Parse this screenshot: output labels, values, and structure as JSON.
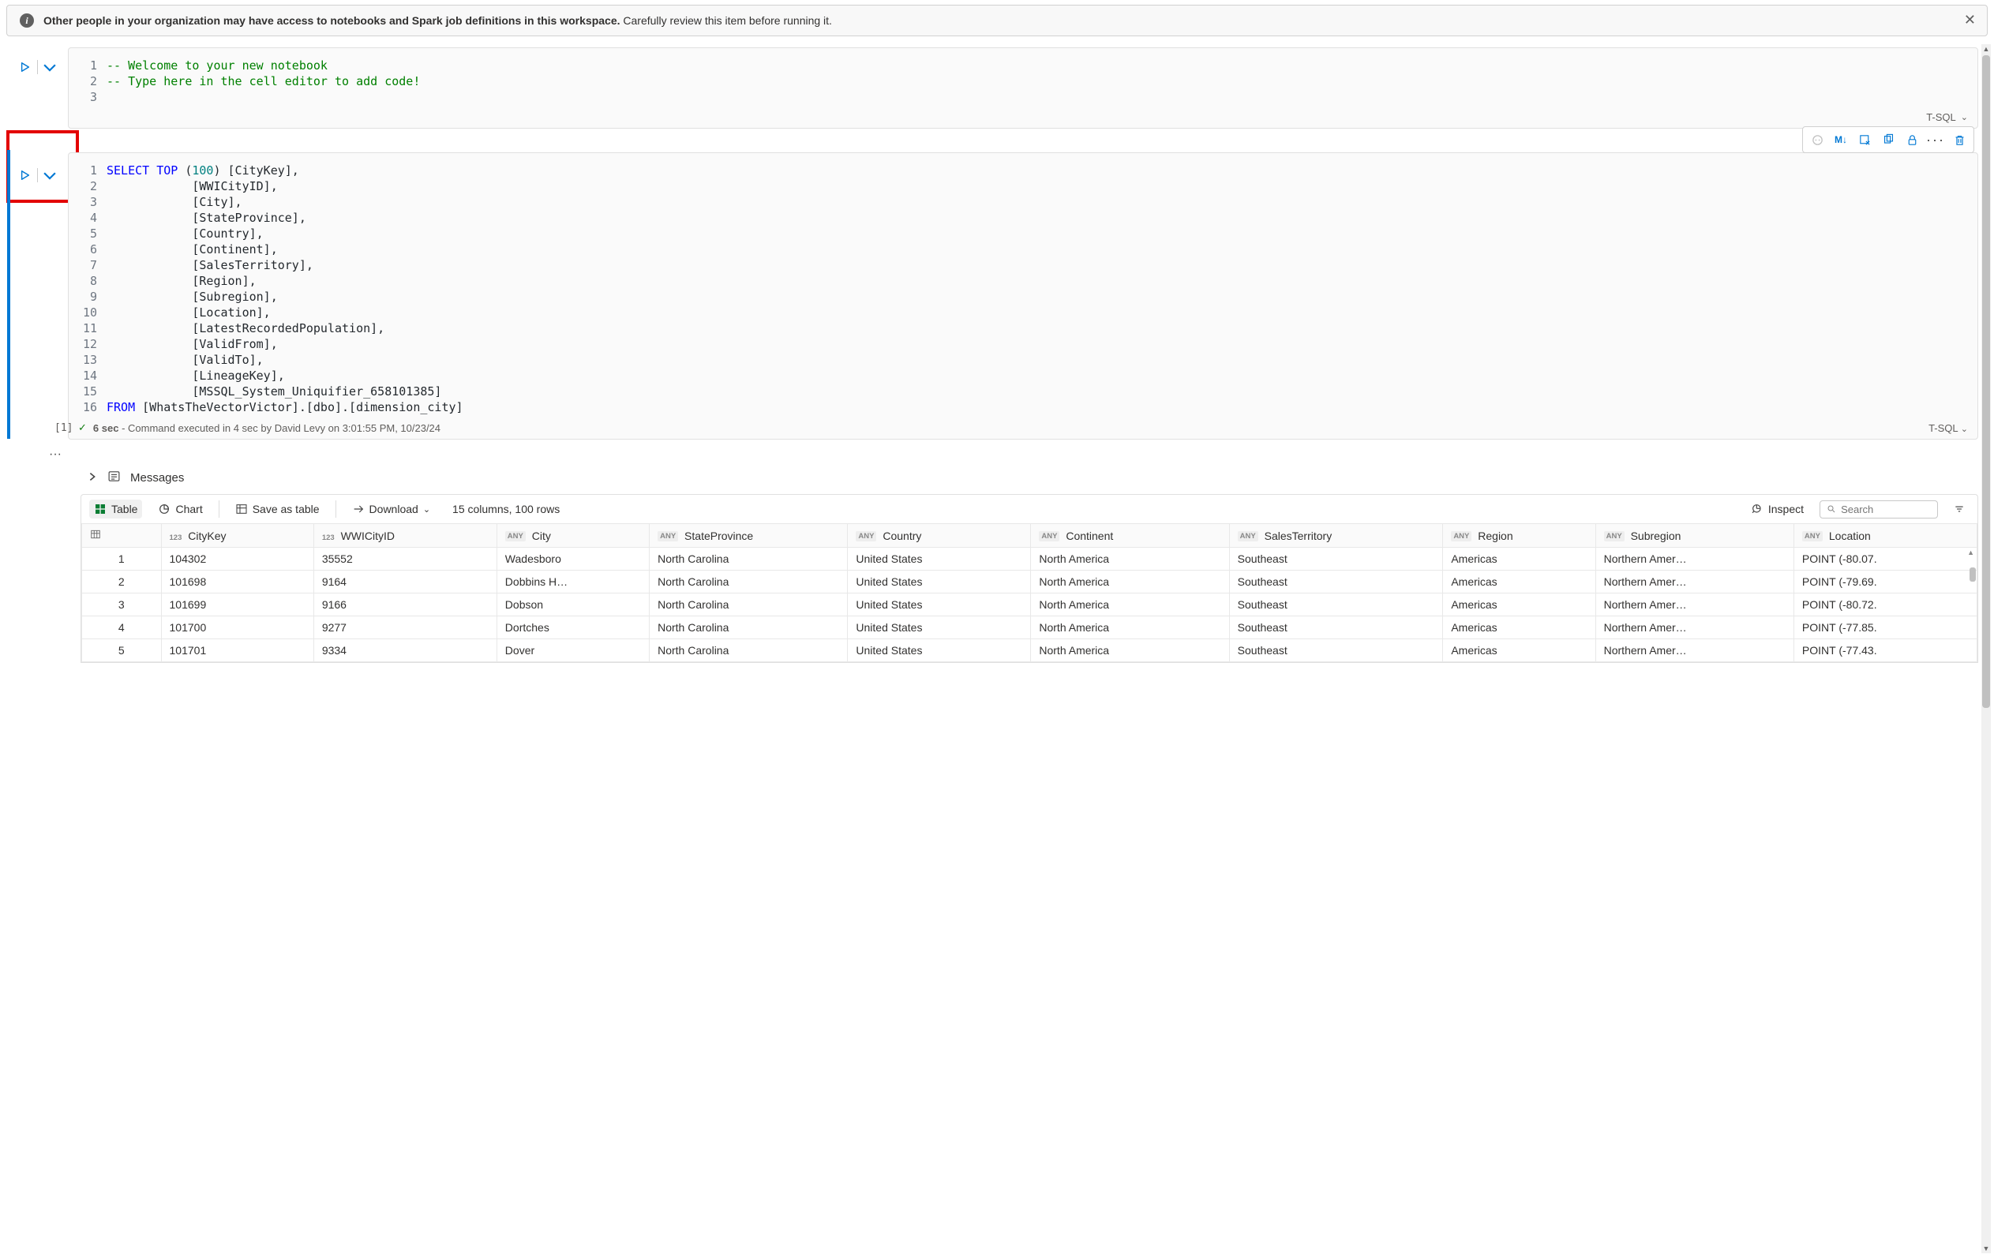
{
  "banner": {
    "bold": "Other people in your organization may have access to notebooks and Spark job definitions in this workspace.",
    "rest": " Carefully review this item before running it."
  },
  "cell1": {
    "lang": "T-SQL",
    "lines": [
      "-- Welcome to your new notebook",
      "-- Type here in the cell editor to add code!",
      ""
    ]
  },
  "cell2": {
    "lang": "T-SQL",
    "exec_index": "[1]",
    "status_prefix": "6 sec",
    "status_rest": " - Command executed in 4 sec by David Levy on 3:01:55 PM, 10/23/24",
    "code_tokens": [
      [
        {
          "c": "kw",
          "t": "SELECT"
        },
        {
          "c": "",
          "t": " "
        },
        {
          "c": "kw",
          "t": "TOP"
        },
        {
          "c": "",
          "t": " ("
        },
        {
          "c": "num",
          "t": "100"
        },
        {
          "c": "",
          "t": ") [CityKey],"
        }
      ],
      [
        {
          "c": "",
          "t": "            [WWICityID],"
        }
      ],
      [
        {
          "c": "",
          "t": "            [City],"
        }
      ],
      [
        {
          "c": "",
          "t": "            [StateProvince],"
        }
      ],
      [
        {
          "c": "",
          "t": "            [Country],"
        }
      ],
      [
        {
          "c": "",
          "t": "            [Continent],"
        }
      ],
      [
        {
          "c": "",
          "t": "            [SalesTerritory],"
        }
      ],
      [
        {
          "c": "",
          "t": "            [Region],"
        }
      ],
      [
        {
          "c": "",
          "t": "            [Subregion],"
        }
      ],
      [
        {
          "c": "",
          "t": "            [Location],"
        }
      ],
      [
        {
          "c": "",
          "t": "            [LatestRecordedPopulation],"
        }
      ],
      [
        {
          "c": "",
          "t": "            [ValidFrom],"
        }
      ],
      [
        {
          "c": "",
          "t": "            [ValidTo],"
        }
      ],
      [
        {
          "c": "",
          "t": "            [LineageKey],"
        }
      ],
      [
        {
          "c": "",
          "t": "            [MSSQL_System_Uniquifier_658101385]"
        }
      ],
      [
        {
          "c": "kw",
          "t": "FROM"
        },
        {
          "c": "",
          "t": " [WhatsTheVectorVictor].[dbo].[dimension_city]"
        }
      ]
    ]
  },
  "toolbar": {
    "markdown_label": "M↓"
  },
  "messages": {
    "label": "Messages"
  },
  "result_bar": {
    "table": "Table",
    "chart": "Chart",
    "save": "Save as table",
    "download": "Download",
    "count": "15 columns, 100 rows",
    "inspect": "Inspect",
    "search_placeholder": "Search"
  },
  "columns": [
    {
      "type": "",
      "label": ""
    },
    {
      "type": "123",
      "label": "CityKey"
    },
    {
      "type": "123",
      "label": "WWICityID"
    },
    {
      "type": "ANY",
      "label": "City"
    },
    {
      "type": "ANY",
      "label": "StateProvince"
    },
    {
      "type": "ANY",
      "label": "Country"
    },
    {
      "type": "ANY",
      "label": "Continent"
    },
    {
      "type": "ANY",
      "label": "SalesTerritory"
    },
    {
      "type": "ANY",
      "label": "Region"
    },
    {
      "type": "ANY",
      "label": "Subregion"
    },
    {
      "type": "ANY",
      "label": "Location"
    }
  ],
  "rows": [
    {
      "idx": "1",
      "CityKey": "104302",
      "WWICityID": "35552",
      "City": "Wadesboro",
      "StateProvince": "North Carolina",
      "Country": "United States",
      "Continent": "North America",
      "SalesTerritory": "Southeast",
      "Region": "Americas",
      "Subregion": "Northern Amer…",
      "Location": "POINT (-80.07."
    },
    {
      "idx": "2",
      "CityKey": "101698",
      "WWICityID": "9164",
      "City": "Dobbins H…",
      "StateProvince": "North Carolina",
      "Country": "United States",
      "Continent": "North America",
      "SalesTerritory": "Southeast",
      "Region": "Americas",
      "Subregion": "Northern Amer…",
      "Location": "POINT (-79.69."
    },
    {
      "idx": "3",
      "CityKey": "101699",
      "WWICityID": "9166",
      "City": "Dobson",
      "StateProvince": "North Carolina",
      "Country": "United States",
      "Continent": "North America",
      "SalesTerritory": "Southeast",
      "Region": "Americas",
      "Subregion": "Northern Amer…",
      "Location": "POINT (-80.72."
    },
    {
      "idx": "4",
      "CityKey": "101700",
      "WWICityID": "9277",
      "City": "Dortches",
      "StateProvince": "North Carolina",
      "Country": "United States",
      "Continent": "North America",
      "SalesTerritory": "Southeast",
      "Region": "Americas",
      "Subregion": "Northern Amer…",
      "Location": "POINT (-77.85."
    },
    {
      "idx": "5",
      "CityKey": "101701",
      "WWICityID": "9334",
      "City": "Dover",
      "StateProvince": "North Carolina",
      "Country": "United States",
      "Continent": "North America",
      "SalesTerritory": "Southeast",
      "Region": "Americas",
      "Subregion": "Northern Amer…",
      "Location": "POINT (-77.43."
    }
  ]
}
